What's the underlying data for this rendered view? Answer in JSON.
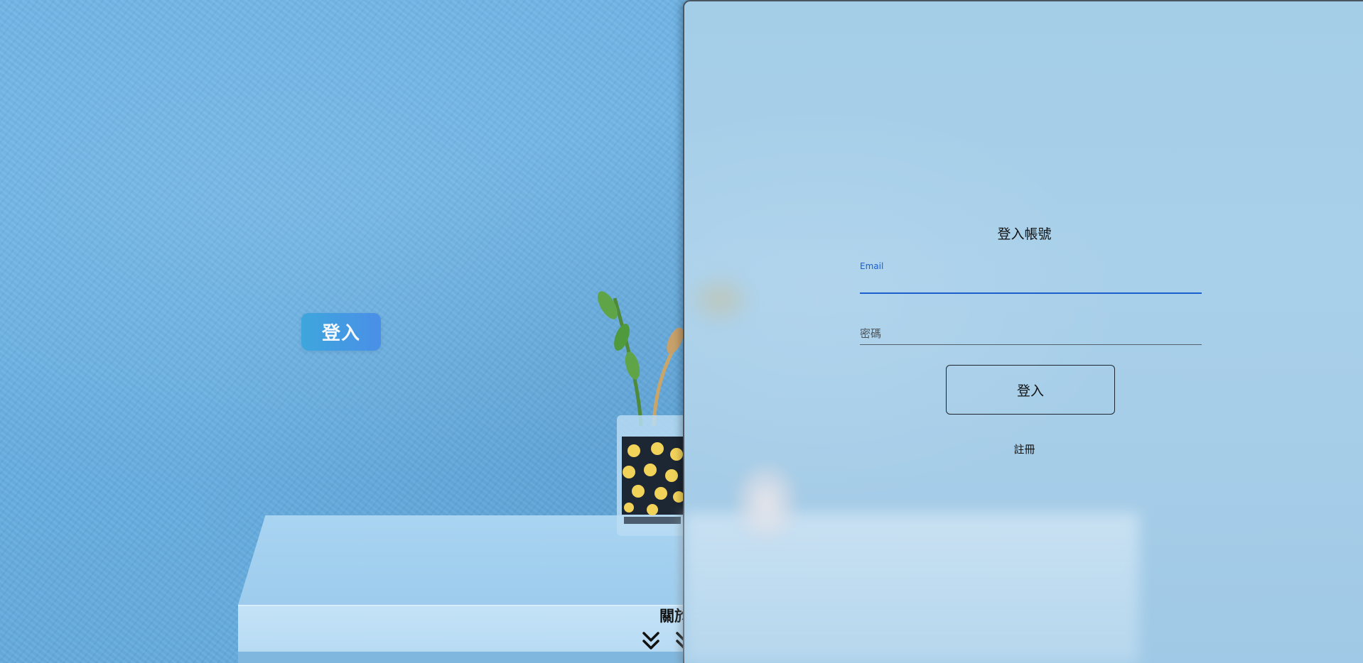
{
  "background": {
    "login_pill_label": "登入",
    "about_label": "關於"
  },
  "form": {
    "title": "登入帳號",
    "email_label": "Email",
    "email_value": "",
    "password_placeholder": "密碼",
    "submit_label": "登入",
    "register_label": "註冊"
  },
  "colors": {
    "accent": "#1a5fcc",
    "wall": "#6db3e6",
    "panel": "#a6cde8"
  },
  "icons": [
    "chevron-double-down-icon"
  ]
}
